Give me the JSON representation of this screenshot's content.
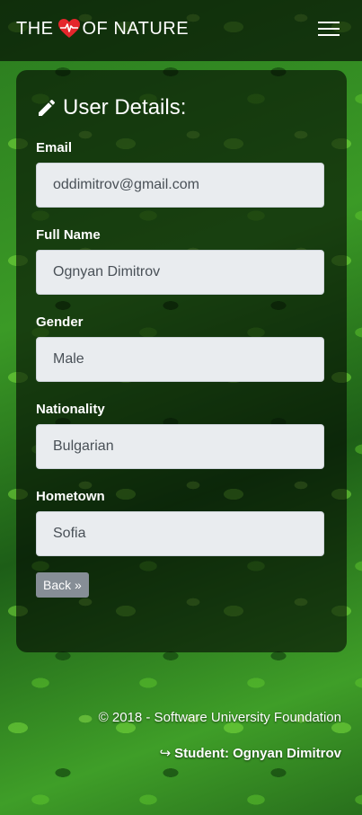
{
  "navbar": {
    "brand_left": "THE",
    "brand_right": "OF NATURE",
    "heart_icon": "heart-pulse-icon",
    "heart_color": "#e5262c",
    "menu_icon": "hamburger-menu-icon"
  },
  "card": {
    "title": "User Details:",
    "title_icon": "pencil-icon",
    "fields": [
      {
        "label": "Email",
        "value": "oddimitrov@gmail.com"
      },
      {
        "label": "Full Name",
        "value": "Ognyan Dimitrov"
      },
      {
        "label": "Gender",
        "value": "Male"
      },
      {
        "label": "Nationality",
        "value": "Bulgarian"
      },
      {
        "label": "Hometown",
        "value": "Sofia"
      }
    ],
    "back_label": "Back »"
  },
  "footer": {
    "copyright": "© 2018 - Software University Foundation",
    "student_icon": "sign-in-arrow-icon",
    "student": "Student: Ognyan Dimitrov"
  },
  "colors": {
    "input_bg": "#e9ecef",
    "button_bg": "#868e96",
    "overlay": "rgba(0,0,0,0.6)"
  }
}
